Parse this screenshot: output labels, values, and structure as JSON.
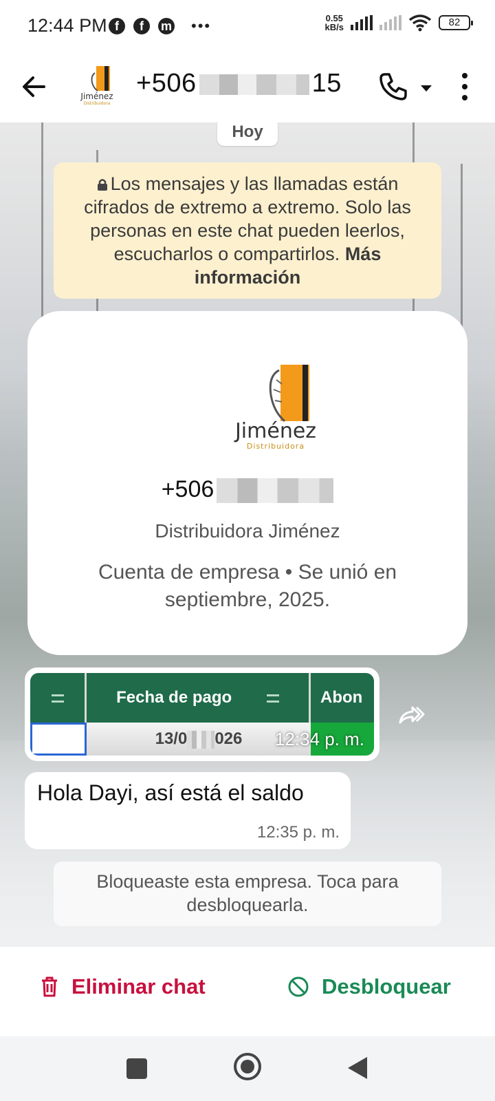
{
  "status_bar": {
    "time": "12:44 PM",
    "network_speed_value": "0.55",
    "network_speed_unit": "kB/s",
    "battery": "82",
    "icons": [
      "facebook-icon",
      "facebook-icon",
      "messenger-icon",
      "more-dots-icon",
      "signal-icon",
      "signal-no-service-icon",
      "wifi-icon",
      "battery-icon"
    ]
  },
  "header": {
    "title_prefix": "+506",
    "title_suffix": "15",
    "avatar_brand": "Jiménez",
    "avatar_sub": "Distribuidora"
  },
  "chat": {
    "date_chip": "Hoy",
    "encryption_notice": "Los mensajes y las llamadas están cifrados de extremo a extremo. Solo las personas en este chat pueden leerlos, escucharlos o compartirlos.",
    "encryption_link": "Más información",
    "profile": {
      "brand": "Jiménez",
      "brand_sub": "Distribuidora",
      "phone_prefix": "+506",
      "name": "Distribuidora Jiménez",
      "info": "Cuenta de empresa • Se unió en septiembre, 2025."
    },
    "image_message": {
      "col_header_1": "Fecha de pago",
      "col_header_2": "Abon",
      "date_cell_start": "13/0",
      "date_cell_end": "026",
      "time": "12:34 p. m."
    },
    "text_message": {
      "body": "Hola Dayi, así está el saldo",
      "time": "12:35 p. m."
    },
    "blocked_notice": "Bloqueaste esta empresa. Toca para desbloquearla."
  },
  "actions": {
    "delete_label": "Eliminar chat",
    "unblock_label": "Desbloquear",
    "delete_color": "#c8103e",
    "unblock_color": "#1a8a55"
  },
  "nav": {
    "icons": [
      "recents-icon",
      "home-icon",
      "back-icon"
    ]
  }
}
